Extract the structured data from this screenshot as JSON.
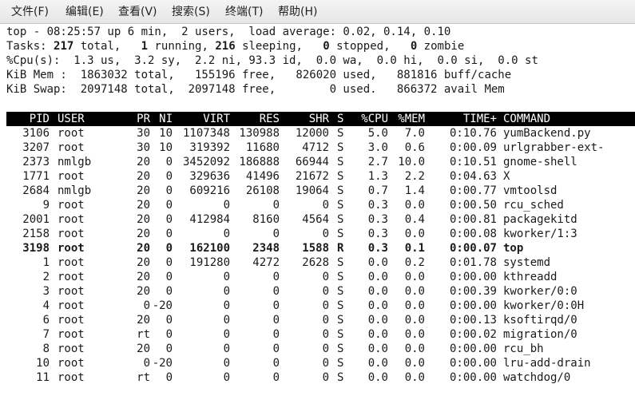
{
  "menubar": {
    "items": [
      "文件(F)",
      "编辑(E)",
      "查看(V)",
      "搜索(S)",
      "终端(T)",
      "帮助(H)"
    ]
  },
  "summary": {
    "line1": "top - 08:25:57 up 6 min,  2 users,  load average: 0.02, 0.14, 0.10",
    "tasks_label": "Tasks:",
    "tasks_total": "217",
    "tasks_rest_1": " total,   ",
    "tasks_running": "1",
    "tasks_rest_2": " running, ",
    "tasks_sleeping": "216",
    "tasks_rest_3": " sleeping,   ",
    "tasks_stopped": "0",
    "tasks_rest_4": " stopped,   ",
    "tasks_zombie": "0",
    "tasks_rest_5": " zombie",
    "cpu": "%Cpu(s):  1.3 us,  3.2 sy,  2.2 ni, 93.3 id,  0.0 wa,  0.0 hi,  0.0 si,  0.0 st",
    "mem": "KiB Mem :  1863032 total,   155196 free,   826020 used,   881816 buff/cache",
    "swap": "KiB Swap:  2097148 total,  2097148 free,        0 used.   866372 avail Mem"
  },
  "table": {
    "columns": [
      "PID",
      "USER",
      "PR",
      "NI",
      "VIRT",
      "RES",
      "SHR",
      "S",
      "%CPU",
      "%MEM",
      "TIME+",
      "COMMAND"
    ],
    "rows": [
      {
        "pid": "3106",
        "user": "root",
        "pr": "30",
        "ni": "10",
        "virt": "1107348",
        "res": "130988",
        "shr": "12000",
        "s": "S",
        "cpu": "5.0",
        "mem": "7.0",
        "time": "0:10.76",
        "command": "yumBackend.py",
        "bold": false
      },
      {
        "pid": "3207",
        "user": "root",
        "pr": "30",
        "ni": "10",
        "virt": "319392",
        "res": "11680",
        "shr": "4712",
        "s": "S",
        "cpu": "3.0",
        "mem": "0.6",
        "time": "0:00.09",
        "command": "urlgrabber-ext-",
        "bold": false
      },
      {
        "pid": "2373",
        "user": "nmlgb",
        "pr": "20",
        "ni": "0",
        "virt": "3452092",
        "res": "186888",
        "shr": "66944",
        "s": "S",
        "cpu": "2.7",
        "mem": "10.0",
        "time": "0:10.51",
        "command": "gnome-shell",
        "bold": false
      },
      {
        "pid": "1771",
        "user": "root",
        "pr": "20",
        "ni": "0",
        "virt": "329636",
        "res": "41496",
        "shr": "21672",
        "s": "S",
        "cpu": "1.3",
        "mem": "2.2",
        "time": "0:04.63",
        "command": "X",
        "bold": false
      },
      {
        "pid": "2684",
        "user": "nmlgb",
        "pr": "20",
        "ni": "0",
        "virt": "609216",
        "res": "26108",
        "shr": "19064",
        "s": "S",
        "cpu": "0.7",
        "mem": "1.4",
        "time": "0:00.77",
        "command": "vmtoolsd",
        "bold": false
      },
      {
        "pid": "9",
        "user": "root",
        "pr": "20",
        "ni": "0",
        "virt": "0",
        "res": "0",
        "shr": "0",
        "s": "S",
        "cpu": "0.3",
        "mem": "0.0",
        "time": "0:00.50",
        "command": "rcu_sched",
        "bold": false
      },
      {
        "pid": "2001",
        "user": "root",
        "pr": "20",
        "ni": "0",
        "virt": "412984",
        "res": "8160",
        "shr": "4564",
        "s": "S",
        "cpu": "0.3",
        "mem": "0.4",
        "time": "0:00.81",
        "command": "packagekitd",
        "bold": false
      },
      {
        "pid": "2158",
        "user": "root",
        "pr": "20",
        "ni": "0",
        "virt": "0",
        "res": "0",
        "shr": "0",
        "s": "S",
        "cpu": "0.3",
        "mem": "0.0",
        "time": "0:00.08",
        "command": "kworker/1:3",
        "bold": false
      },
      {
        "pid": "3198",
        "user": "root",
        "pr": "20",
        "ni": "0",
        "virt": "162100",
        "res": "2348",
        "shr": "1588",
        "s": "R",
        "cpu": "0.3",
        "mem": "0.1",
        "time": "0:00.07",
        "command": "top",
        "bold": true
      },
      {
        "pid": "1",
        "user": "root",
        "pr": "20",
        "ni": "0",
        "virt": "191280",
        "res": "4272",
        "shr": "2628",
        "s": "S",
        "cpu": "0.0",
        "mem": "0.2",
        "time": "0:01.78",
        "command": "systemd",
        "bold": false
      },
      {
        "pid": "2",
        "user": "root",
        "pr": "20",
        "ni": "0",
        "virt": "0",
        "res": "0",
        "shr": "0",
        "s": "S",
        "cpu": "0.0",
        "mem": "0.0",
        "time": "0:00.00",
        "command": "kthreadd",
        "bold": false
      },
      {
        "pid": "3",
        "user": "root",
        "pr": "20",
        "ni": "0",
        "virt": "0",
        "res": "0",
        "shr": "0",
        "s": "S",
        "cpu": "0.0",
        "mem": "0.0",
        "time": "0:00.39",
        "command": "kworker/0:0",
        "bold": false
      },
      {
        "pid": "4",
        "user": "root",
        "pr": "0",
        "ni": "-20",
        "virt": "0",
        "res": "0",
        "shr": "0",
        "s": "S",
        "cpu": "0.0",
        "mem": "0.0",
        "time": "0:00.00",
        "command": "kworker/0:0H",
        "bold": false
      },
      {
        "pid": "6",
        "user": "root",
        "pr": "20",
        "ni": "0",
        "virt": "0",
        "res": "0",
        "shr": "0",
        "s": "S",
        "cpu": "0.0",
        "mem": "0.0",
        "time": "0:00.13",
        "command": "ksoftirqd/0",
        "bold": false
      },
      {
        "pid": "7",
        "user": "root",
        "pr": "rt",
        "ni": "0",
        "virt": "0",
        "res": "0",
        "shr": "0",
        "s": "S",
        "cpu": "0.0",
        "mem": "0.0",
        "time": "0:00.02",
        "command": "migration/0",
        "bold": false
      },
      {
        "pid": "8",
        "user": "root",
        "pr": "20",
        "ni": "0",
        "virt": "0",
        "res": "0",
        "shr": "0",
        "s": "S",
        "cpu": "0.0",
        "mem": "0.0",
        "time": "0:00.00",
        "command": "rcu_bh",
        "bold": false
      },
      {
        "pid": "10",
        "user": "root",
        "pr": "0",
        "ni": "-20",
        "virt": "0",
        "res": "0",
        "shr": "0",
        "s": "S",
        "cpu": "0.0",
        "mem": "0.0",
        "time": "0:00.00",
        "command": "lru-add-drain",
        "bold": false
      },
      {
        "pid": "11",
        "user": "root",
        "pr": "rt",
        "ni": "0",
        "virt": "0",
        "res": "0",
        "shr": "0",
        "s": "S",
        "cpu": "0.0",
        "mem": "0.0",
        "time": "0:00.00",
        "command": "watchdog/0",
        "bold": false
      }
    ]
  }
}
